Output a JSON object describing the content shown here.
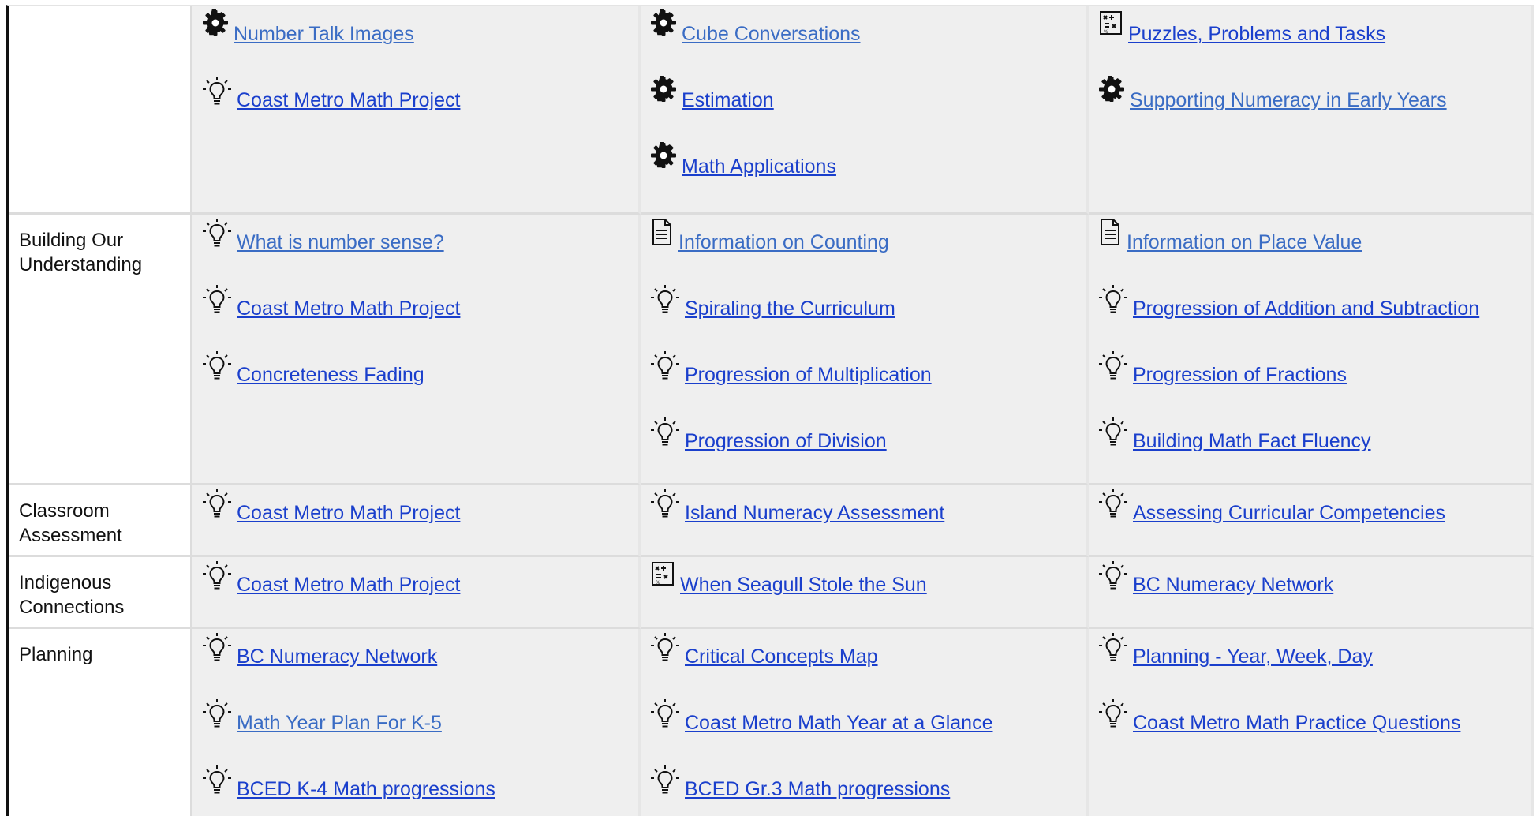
{
  "colors": {
    "link": "#1a3fcc",
    "link_visited": "#3a6cc4",
    "cell_bg": "#efefef",
    "border": "#111111"
  },
  "rows": [
    {
      "label": "",
      "cols": [
        [
          {
            "icon": "gear-icon",
            "text": "Number Talk Images",
            "style": "alt"
          },
          {
            "icon": "lightbulb-icon",
            "text": "Coast Metro Math Project"
          }
        ],
        [
          {
            "icon": "gear-icon",
            "text": "Cube Conversations",
            "style": "alt"
          },
          {
            "icon": "gear-icon",
            "text": "Estimation"
          },
          {
            "icon": "gear-icon",
            "text": "Math Applications"
          }
        ],
        [
          {
            "icon": "puzzle-icon",
            "text": "Puzzles, Problems and Tasks"
          },
          {
            "icon": "gear-icon",
            "text": "Supporting Numeracy in Early Years",
            "style": "alt"
          }
        ]
      ]
    },
    {
      "label": "Building Our Understanding",
      "cols": [
        [
          {
            "icon": "lightbulb-icon",
            "text": "What is number sense?",
            "style": "alt"
          },
          {
            "icon": "lightbulb-icon",
            "text": " Coast Metro Math Project"
          },
          {
            "icon": "lightbulb-icon",
            "text": "Concreteness Fading"
          }
        ],
        [
          {
            "icon": "document-icon",
            "text": "Information on Counting",
            "style": "alt"
          },
          {
            "icon": "lightbulb-icon",
            "text": "Spiraling the Curriculum"
          },
          {
            "icon": "lightbulb-icon",
            "text": "Progression of Multiplication"
          },
          {
            "icon": "lightbulb-icon",
            "text": "Progression of Division"
          }
        ],
        [
          {
            "icon": "document-icon",
            "text": "Information on Place Value",
            "style": "alt"
          },
          {
            "icon": "lightbulb-icon",
            "text": "Progression of Addition and Subtraction"
          },
          {
            "icon": "lightbulb-icon",
            "text": "Progression of Fractions"
          },
          {
            "icon": "lightbulb-icon",
            "text": "Building Math Fact Fluency"
          }
        ]
      ]
    },
    {
      "label": "Classroom Assessment",
      "cols": [
        [
          {
            "icon": "lightbulb-icon",
            "text": "Coast Metro Math Project"
          }
        ],
        [
          {
            "icon": "lightbulb-icon",
            "text": "Island Numeracy Assessment"
          }
        ],
        [
          {
            "icon": "lightbulb-icon",
            "text": "Assessing Curricular Competencies"
          }
        ]
      ]
    },
    {
      "label": "Indigenous Connections",
      "cols": [
        [
          {
            "icon": "lightbulb-icon",
            "text": "Coast Metro Math Project"
          }
        ],
        [
          {
            "icon": "puzzle-icon",
            "text": "When Seagull Stole the Sun"
          }
        ],
        [
          {
            "icon": "lightbulb-icon",
            "text": "BC Numeracy Network"
          }
        ]
      ]
    },
    {
      "label": "Planning",
      "cols": [
        [
          {
            "icon": "lightbulb-icon",
            "text": "BC Numeracy Network"
          },
          {
            "icon": "lightbulb-icon",
            "text": "Math Year Plan For K-5",
            "style": "alt"
          },
          {
            "icon": "lightbulb-icon",
            "text": "BCED K-4 Math progressions"
          }
        ],
        [
          {
            "icon": "lightbulb-icon",
            "text": "Critical Concepts Map"
          },
          {
            "icon": "lightbulb-icon",
            "text": "Coast Metro Math Year at a Glance"
          },
          {
            "icon": "lightbulb-icon",
            "text": "BCED Gr.3 Math progressions"
          }
        ],
        [
          {
            "icon": "lightbulb-icon",
            "text": "Planning - Year, Week, Day"
          },
          {
            "icon": "lightbulb-icon",
            "text": "Coast Metro Math Practice Questions"
          }
        ]
      ]
    }
  ]
}
